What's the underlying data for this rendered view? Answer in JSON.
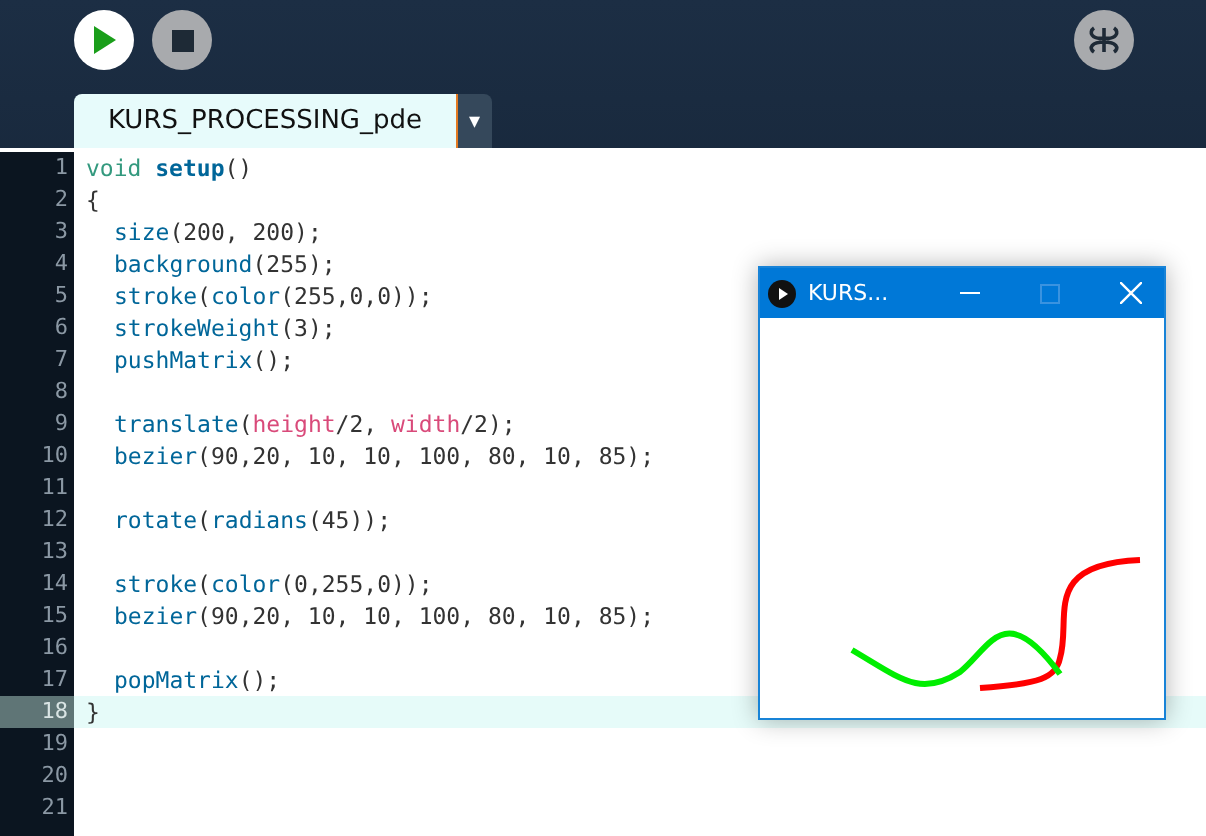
{
  "tabs": [
    {
      "label": "KURS_PROCESSING_pde",
      "selected": true
    }
  ],
  "tab_menu": "▾",
  "editor": {
    "lines": [
      {
        "number": "1",
        "current": false,
        "indented": false,
        "tokens": [
          {
            "text": "void ",
            "kind": "keyword"
          },
          {
            "text": "setup",
            "kind": "function"
          },
          {
            "text": "()",
            "kind": "plain"
          }
        ]
      },
      {
        "number": "2",
        "current": false,
        "indented": false,
        "tokens": [
          {
            "text": "{",
            "kind": "plain"
          }
        ]
      },
      {
        "number": "3",
        "current": false,
        "indented": true,
        "tokens": [
          {
            "text": "size",
            "kind": "builtin"
          },
          {
            "text": "(200, 200);",
            "kind": "plain"
          }
        ]
      },
      {
        "number": "4",
        "current": false,
        "indented": true,
        "tokens": [
          {
            "text": "background",
            "kind": "builtin"
          },
          {
            "text": "(255);",
            "kind": "plain"
          }
        ]
      },
      {
        "number": "5",
        "current": false,
        "indented": true,
        "tokens": [
          {
            "text": "stroke",
            "kind": "builtin"
          },
          {
            "text": "(",
            "kind": "plain"
          },
          {
            "text": "color",
            "kind": "builtin"
          },
          {
            "text": "(255,0,0));",
            "kind": "plain"
          }
        ]
      },
      {
        "number": "6",
        "current": false,
        "indented": true,
        "tokens": [
          {
            "text": "strokeWeight",
            "kind": "builtin"
          },
          {
            "text": "(3);",
            "kind": "plain"
          }
        ]
      },
      {
        "number": "7",
        "current": false,
        "indented": true,
        "tokens": [
          {
            "text": "pushMatrix",
            "kind": "builtin"
          },
          {
            "text": "();",
            "kind": "plain"
          }
        ]
      },
      {
        "number": "8",
        "current": false
      },
      {
        "number": "9",
        "current": false,
        "indented": true,
        "tokens": [
          {
            "text": "translate",
            "kind": "builtin"
          },
          {
            "text": "(",
            "kind": "plain"
          },
          {
            "text": "height",
            "kind": "variable"
          },
          {
            "text": "/2, ",
            "kind": "plain"
          },
          {
            "text": "width",
            "kind": "variable"
          },
          {
            "text": "/2);",
            "kind": "plain"
          }
        ]
      },
      {
        "number": "10",
        "current": false,
        "indented": true,
        "tokens": [
          {
            "text": "bezier",
            "kind": "builtin"
          },
          {
            "text": "(90,20, 10, 10, 100, 80, 10, 85);",
            "kind": "plain"
          }
        ]
      },
      {
        "number": "11",
        "current": false
      },
      {
        "number": "12",
        "current": false,
        "indented": true,
        "tokens": [
          {
            "text": "rotate",
            "kind": "builtin"
          },
          {
            "text": "(",
            "kind": "plain"
          },
          {
            "text": "radians",
            "kind": "builtin"
          },
          {
            "text": "(45));",
            "kind": "plain"
          }
        ]
      },
      {
        "number": "13",
        "current": false
      },
      {
        "number": "14",
        "current": false,
        "indented": true,
        "tokens": [
          {
            "text": "stroke",
            "kind": "builtin"
          },
          {
            "text": "(",
            "kind": "plain"
          },
          {
            "text": "color",
            "kind": "builtin"
          },
          {
            "text": "(0,255,0));",
            "kind": "plain"
          }
        ]
      },
      {
        "number": "15",
        "current": false,
        "indented": true,
        "tokens": [
          {
            "text": "bezier",
            "kind": "builtin"
          },
          {
            "text": "(90,20, 10, 10, 100, 80, 10, 85);",
            "kind": "plain"
          }
        ]
      },
      {
        "number": "16",
        "current": false
      },
      {
        "number": "17",
        "current": false,
        "indented": true,
        "tokens": [
          {
            "text": "popMatrix",
            "kind": "builtin"
          },
          {
            "text": "();",
            "kind": "plain"
          }
        ]
      },
      {
        "number": "18",
        "current": true,
        "indented": false,
        "tokens": [
          {
            "text": "}",
            "kind": "plain"
          }
        ]
      },
      {
        "number": "19",
        "current": false
      },
      {
        "number": "20",
        "current": false
      },
      {
        "number": "21",
        "current": false
      }
    ]
  },
  "sketch_window": {
    "title": "KURS..."
  }
}
